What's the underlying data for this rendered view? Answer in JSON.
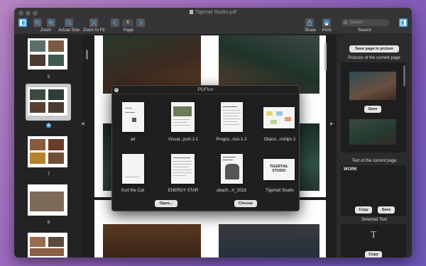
{
  "window": {
    "title": "Tigertail Studio.pdf"
  },
  "toolbar": {
    "zoom_label": "Zoom",
    "actual_size_label": "Actual Size",
    "zoom_to_fit_label": "Zoom to Fit",
    "page_label": "Page",
    "page_value": "6",
    "share_label": "Share",
    "print_label": "Print",
    "search_placeholder": "Search",
    "search_label": "Search"
  },
  "sidebar": {
    "pages": [
      "5",
      "6",
      "7",
      "8"
    ]
  },
  "right_panel": {
    "save_page_button": "Save page to picture",
    "pictures_label": "Pictures of the current page",
    "save_button": "Save",
    "text_label": "Text of the current page",
    "text_content": "WORK",
    "copy_button": "Copy",
    "save_text_button": "Save",
    "selected_text_label": "Selected Text",
    "copy_selected_button": "Copy"
  },
  "modal": {
    "title": "PDFfun",
    "files": [
      "ad",
      "Visual...port-1-1",
      "Progra...nce-1-2",
      "Object...nships 2",
      "Kurt the Cat",
      "ENERGY STAR",
      "attach...rt_2018",
      "Tigertail Studio"
    ],
    "open_button": "Open...",
    "choose_button": "Choose"
  },
  "colors": {
    "window_bg": "#2b2b2d",
    "accent": "#4aa3df"
  }
}
